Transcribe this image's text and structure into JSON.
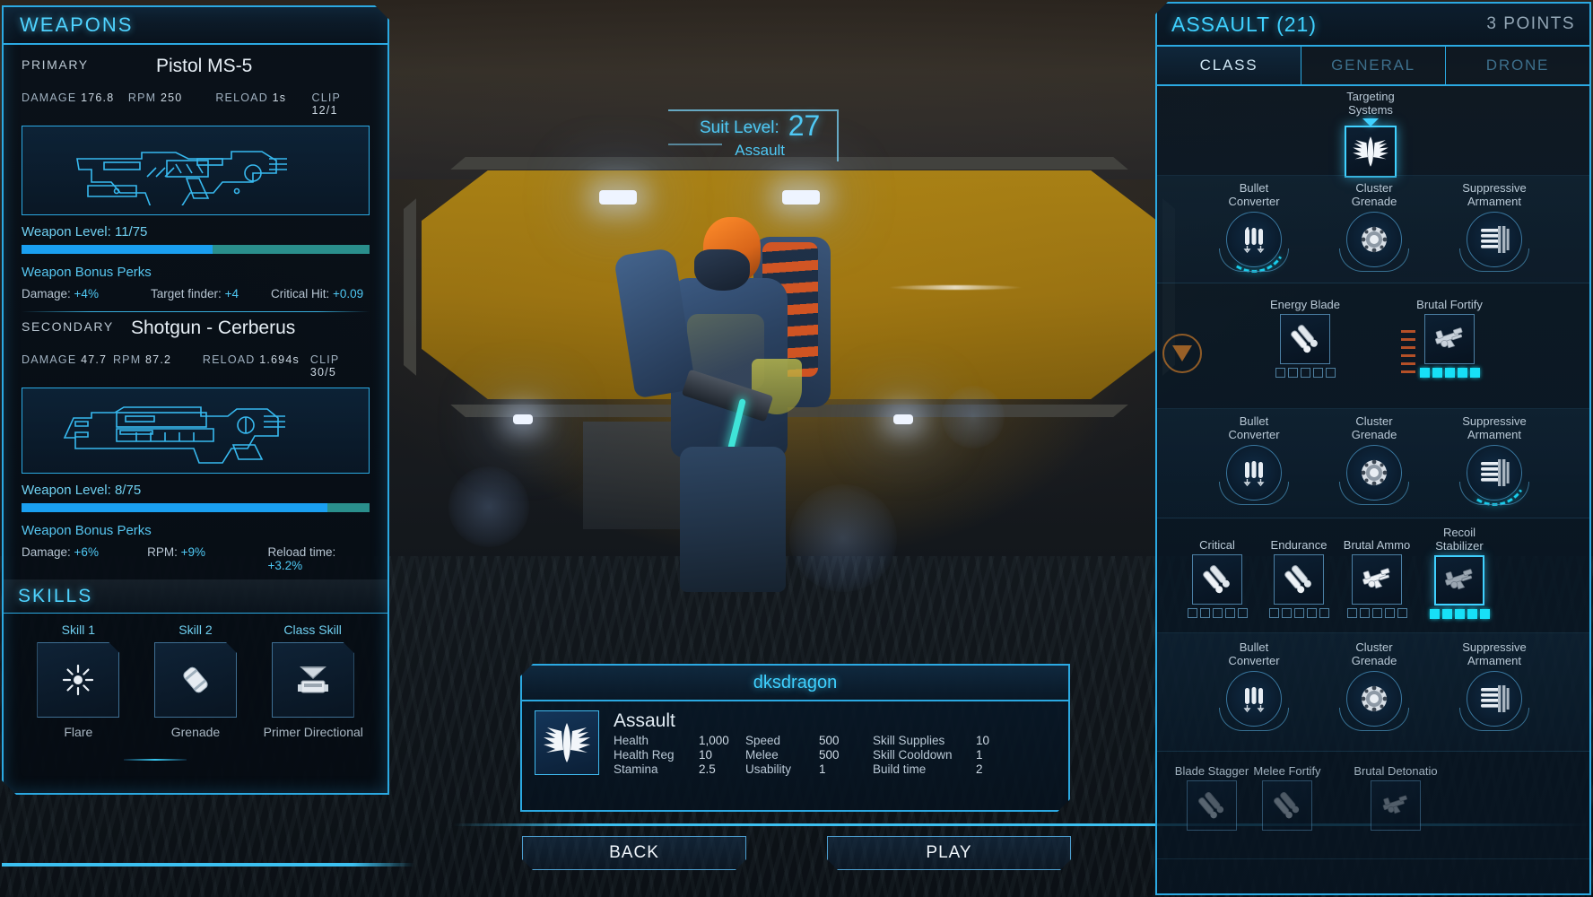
{
  "scene": {
    "alt": "hangar-bay-with-assault-suit"
  },
  "left_panel": {
    "header": "WEAPONS",
    "weapons": [
      {
        "slot": "PRIMARY",
        "name": "Pistol MS-5",
        "stats": [
          {
            "label": "DAMAGE",
            "value": "176.8"
          },
          {
            "label": "RPM",
            "value": "250"
          },
          {
            "label": "RELOAD",
            "value": "1s"
          },
          {
            "label": "CLIP",
            "value": "12/1"
          }
        ],
        "level_label": "Weapon Level:",
        "level_value": "11/75",
        "level_pct": 55,
        "level_pct_b": 100,
        "perks_title": "Weapon Bonus Perks",
        "perks": [
          {
            "label": "Damage:",
            "value": "+4%"
          },
          {
            "label": "Target finder:",
            "value": "+4"
          },
          {
            "label": "Critical Hit:",
            "value": "+0.09"
          }
        ],
        "icon": "pistol-icon"
      },
      {
        "slot": "SECONDARY",
        "name": "Shotgun - Cerberus",
        "stats": [
          {
            "label": "DAMAGE",
            "value": "47.7"
          },
          {
            "label": "RPM",
            "value": "87.2"
          },
          {
            "label": "RELOAD",
            "value": "1.694s"
          },
          {
            "label": "CLIP",
            "value": "30/5"
          }
        ],
        "level_label": "Weapon Level:",
        "level_value": "8/75",
        "level_pct": 88,
        "level_pct_b": 100,
        "perks_title": "Weapon Bonus Perks",
        "perks": [
          {
            "label": "Damage:",
            "value": "+6%"
          },
          {
            "label": "RPM:",
            "value": "+9%"
          },
          {
            "label": "Reload time:",
            "value": "+3.2%"
          }
        ],
        "icon": "shotgun-icon"
      }
    ],
    "skills_header": "SKILLS",
    "skills": [
      {
        "caption": "Skill 1",
        "name": "Flare",
        "icon": "flare-icon"
      },
      {
        "caption": "Skill 2",
        "name": "Grenade",
        "icon": "grenade-icon"
      },
      {
        "caption": "Class Skill",
        "name": "Primer Directional",
        "icon": "primer-directional-icon"
      }
    ]
  },
  "center": {
    "suit_level_label": "Suit Level:",
    "suit_level_value": "27",
    "suit_class": "Assault",
    "character_card": {
      "player_name": "dksdragon",
      "class_name": "Assault",
      "badge_icon": "assault-wings-icon",
      "stats": [
        {
          "label": "Health",
          "value": "1,000"
        },
        {
          "label": "Speed",
          "value": "500"
        },
        {
          "label": "Skill Supplies",
          "value": "10"
        },
        {
          "label": "Health Reg",
          "value": "10"
        },
        {
          "label": "Melee",
          "value": "500"
        },
        {
          "label": "Skill Cooldown",
          "value": "1"
        },
        {
          "label": "Stamina",
          "value": "2.5"
        },
        {
          "label": "Usability",
          "value": "1"
        },
        {
          "label": "Build time",
          "value": "2"
        }
      ]
    },
    "back_button": "BACK",
    "play_button": "PLAY"
  },
  "right_panel": {
    "title": "ASSAULT (21)",
    "points": "3 POINTS",
    "tabs": [
      {
        "label": "CLASS",
        "active": true
      },
      {
        "label": "GENERAL",
        "active": false
      },
      {
        "label": "DRONE",
        "active": false
      }
    ],
    "tiers": [
      {
        "nodes": [
          {
            "caption": "Targeting\nSystems",
            "icon": "assault-wings-icon",
            "shape": "square-big",
            "selected": true,
            "arrow": true
          }
        ]
      },
      {
        "nodes": [
          {
            "caption": "Bullet\nConverter",
            "icon": "bullet-converter-icon",
            "shape": "circle",
            "arc": true
          },
          {
            "caption": "Cluster\nGrenade",
            "icon": "cluster-grenade-icon",
            "shape": "circle",
            "arc": false
          },
          {
            "caption": "Suppressive\nArmament",
            "icon": "suppressive-armament-icon",
            "shape": "circle",
            "arc": false
          }
        ]
      },
      {
        "nodes": [
          {
            "caption": "Energy Blade",
            "icon": "energy-blade-icon",
            "shape": "square",
            "pips": 5,
            "pips_on": 0
          },
          {
            "caption": "Brutal Fortify",
            "icon": "brutal-rifle-icon",
            "shape": "square",
            "pips": 5,
            "pips_on": 5
          }
        ]
      },
      {
        "nodes": [
          {
            "caption": "Bullet\nConverter",
            "icon": "bullet-converter-icon",
            "shape": "circle",
            "arc": false
          },
          {
            "caption": "Cluster\nGrenade",
            "icon": "cluster-grenade-icon",
            "shape": "circle",
            "arc": false
          },
          {
            "caption": "Suppressive\nArmament",
            "icon": "suppressive-armament-icon",
            "shape": "circle",
            "arc": true
          }
        ]
      },
      {
        "nodes": [
          {
            "caption": "Critical",
            "icon": "energy-blade-icon",
            "shape": "square",
            "pips": 5,
            "pips_on": 0
          },
          {
            "caption": "Endurance",
            "icon": "energy-blade-icon",
            "shape": "square",
            "pips": 5,
            "pips_on": 0
          },
          {
            "caption": "Brutal Ammo",
            "icon": "brutal-rifle-icon",
            "shape": "square",
            "pips": 5,
            "pips_on": 0
          },
          {
            "caption": "Recoil\nStabilizer",
            "icon": "brutal-rifle-icon",
            "shape": "square",
            "pips": 5,
            "pips_on": 5,
            "selected": true
          }
        ]
      },
      {
        "nodes": [
          {
            "caption": "Bullet\nConverter",
            "icon": "bullet-converter-icon",
            "shape": "circle",
            "arc": false
          },
          {
            "caption": "Cluster\nGrenade",
            "icon": "cluster-grenade-icon",
            "shape": "circle",
            "arc": false
          },
          {
            "caption": "Suppressive\nArmament",
            "icon": "suppressive-armament-icon",
            "shape": "circle",
            "arc": false
          }
        ]
      },
      {
        "nodes": [
          {
            "caption": "Blade Stagger",
            "icon": "energy-blade-icon",
            "shape": "square",
            "dim": true
          },
          {
            "caption": "Melee Fortify",
            "icon": "energy-blade-icon",
            "shape": "square",
            "dim": true
          },
          {
            "caption": "Brutal Detonatio",
            "icon": "brutal-rifle-icon",
            "shape": "square",
            "dim": true
          }
        ]
      }
    ]
  },
  "colors": {
    "accent_cyan": "#3fd1ff",
    "panel_border": "#2ba9e2",
    "bar_fill": "#1a9ff0",
    "bar_fill_alt": "#2a8f8c",
    "pip_on": "#17e0f7",
    "text_primary": "#e6eef5",
    "text_muted": "#9fb0bf"
  }
}
